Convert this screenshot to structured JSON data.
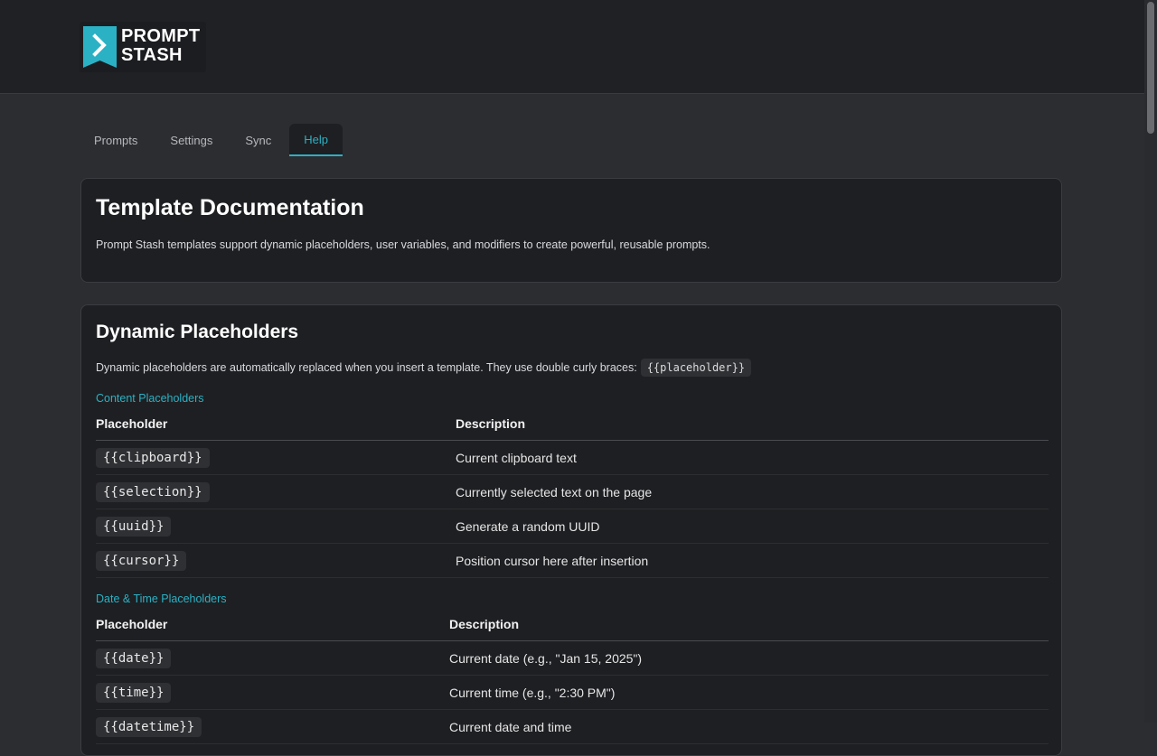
{
  "brand": {
    "line1": "PROMPT",
    "line2": "STASH",
    "accent": "#2bb1c4"
  },
  "tabs": [
    {
      "label": "Prompts"
    },
    {
      "label": "Settings"
    },
    {
      "label": "Sync"
    },
    {
      "label": "Help",
      "active": true
    }
  ],
  "intro": {
    "title": "Template Documentation",
    "description": "Prompt Stash templates support dynamic placeholders, user variables, and modifiers to create powerful, reusable prompts."
  },
  "dynamic": {
    "title": "Dynamic Placeholders",
    "description": "Dynamic placeholders are automatically replaced when you insert a template. They use double curly braces:",
    "example_code": "{{placeholder}}",
    "content": {
      "heading": "Content Placeholders",
      "col_placeholder": "Placeholder",
      "col_description": "Description",
      "rows": [
        {
          "code": "{{clipboard}}",
          "desc": "Current clipboard text"
        },
        {
          "code": "{{selection}}",
          "desc": "Currently selected text on the page"
        },
        {
          "code": "{{uuid}}",
          "desc": "Generate a random UUID"
        },
        {
          "code": "{{cursor}}",
          "desc": "Position cursor here after insertion"
        }
      ]
    },
    "datetime": {
      "heading": "Date & Time Placeholders",
      "col_placeholder": "Placeholder",
      "col_description": "Description",
      "rows": [
        {
          "code": "{{date}}",
          "desc": "Current date (e.g., \"Jan 15, 2025\")"
        },
        {
          "code": "{{time}}",
          "desc": "Current time (e.g., \"2:30 PM\")"
        },
        {
          "code": "{{datetime}}",
          "desc": "Current date and time"
        }
      ]
    }
  }
}
